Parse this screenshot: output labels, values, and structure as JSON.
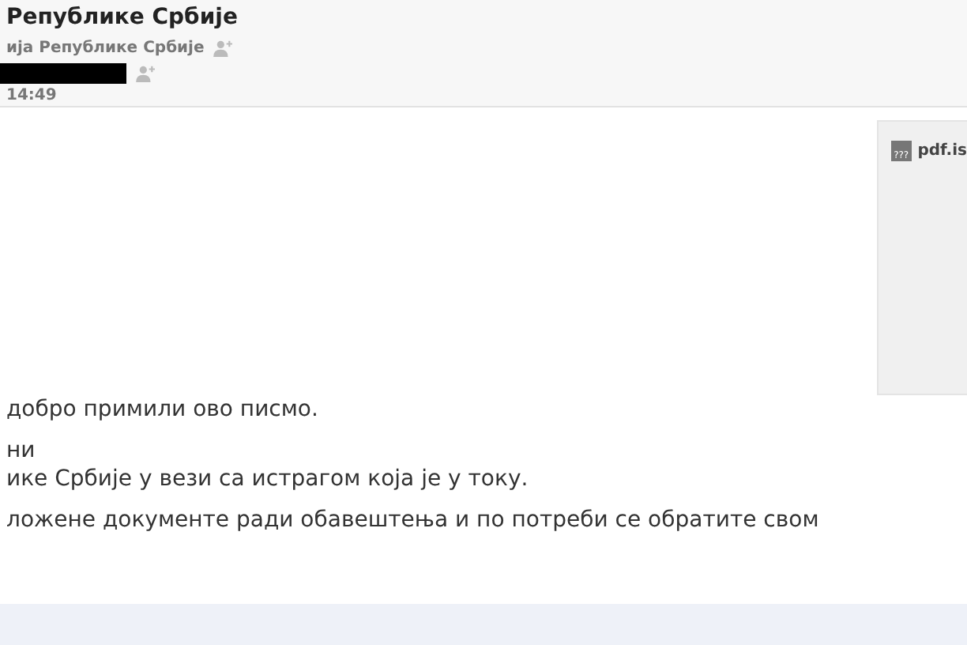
{
  "header": {
    "subject": "Републике Србије",
    "sender": "ија Републике Србије",
    "time": "14:49"
  },
  "attachment": {
    "name": "pdf.is",
    "icon_text": "???"
  },
  "body": [
    "добро примили ово писмо.",
    "ни",
    "ике Србије у вези са истрагом која је у току.",
    "ложене документе ради обавештења и по потреби се обратите свом"
  ]
}
